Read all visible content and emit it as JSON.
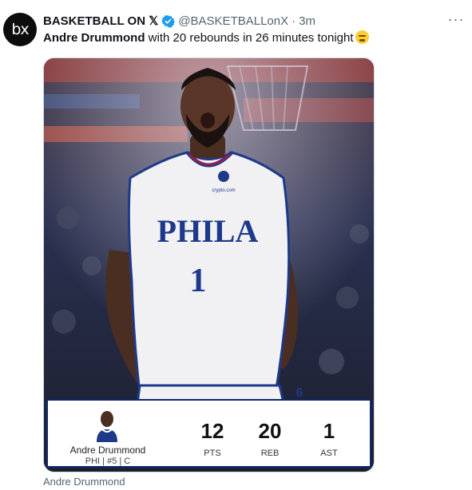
{
  "author": {
    "avatar_text": "bx",
    "display_name": "BASKETBALL ON 𝕏",
    "handle": "@BASKETBALLonX",
    "separator": "·",
    "time": "3m"
  },
  "more_label": "···",
  "tweet": {
    "bold_text": "Andre Drummond",
    "text": " with 20 rebounds in 26 minutes tonight"
  },
  "jersey": {
    "team": "PHILA",
    "number": "1",
    "sponsor": "crypto.com",
    "logo": "6"
  },
  "statcard": {
    "player_name": "Andre Drummond",
    "player_info": "PHI  |  #5  |  C",
    "stats": [
      {
        "value": "12",
        "label": "PTS"
      },
      {
        "value": "20",
        "label": "REB"
      },
      {
        "value": "1",
        "label": "AST"
      }
    ]
  },
  "media_caption": "Andre Drummond",
  "colors": {
    "verified": "#1d9bf0",
    "card_border": "#0e2a6b",
    "jersey_blue": "#1d3a8a",
    "jersey_red": "#c8102e"
  }
}
